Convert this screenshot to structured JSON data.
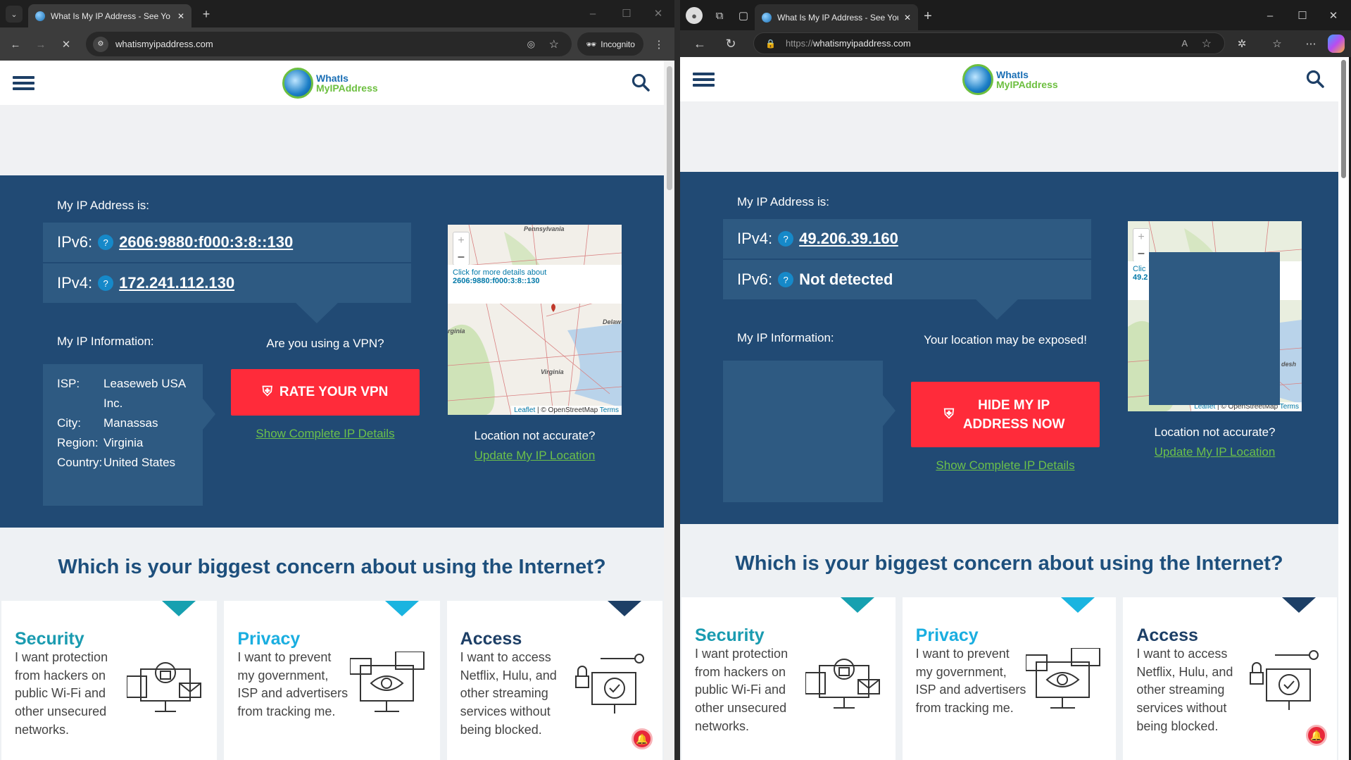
{
  "left": {
    "tab_title": "What Is My IP Address - See Yo",
    "url": "whatismyipaddress.com",
    "incognito_label": "Incognito",
    "page": {
      "logo_text": [
        "WhatIs",
        "MyIPAddress"
      ],
      "ip_heading": "My IP Address is:",
      "rows": [
        {
          "label": "IPv6:",
          "value": "2606:9880:f000:3:8::130"
        },
        {
          "label": "IPv4:",
          "value": "172.241.112.130"
        }
      ],
      "info_heading": "My IP Information:",
      "cta_heading": "Are you using a VPN?",
      "info": [
        {
          "key": "ISP:",
          "value": "Leaseweb USA Inc."
        },
        {
          "key": "City:",
          "value": "Manassas"
        },
        {
          "key": "Region:",
          "value": "Virginia"
        },
        {
          "key": "Country:",
          "value": "United States"
        }
      ],
      "cta_button": "RATE YOUR VPN",
      "details_link": "Show Complete IP Details",
      "map": {
        "popup_line1": "Click for more details about",
        "popup_line2": "2606:9880:f000:3:8::130",
        "labels": [
          "Pennsylvania",
          "Delaw",
          "rginia",
          "Virginia"
        ],
        "attribution": [
          "Leaflet",
          "© OpenStreetMap",
          "Terms"
        ]
      },
      "loc_question": "Location not accurate?",
      "loc_link": "Update My IP Location"
    }
  },
  "right": {
    "tab_title": "What Is My IP Address - See Your",
    "url_scheme": "https://",
    "url": "whatismyipaddress.com",
    "page": {
      "logo_text": [
        "WhatIs",
        "MyIPAddress"
      ],
      "ip_heading": "My IP Address is:",
      "rows": [
        {
          "label": "IPv4:",
          "value": "49.206.39.160"
        },
        {
          "label": "IPv6:",
          "value": "Not detected"
        }
      ],
      "info_heading": "My IP Information:",
      "cta_heading": "Your location may be exposed!",
      "cta_button": "HIDE MY IP ADDRESS NOW",
      "details_link": "Show Complete IP Details",
      "map": {
        "popup_line1": "Clic",
        "popup_line2": "49.2",
        "labels": [
          "desh"
        ],
        "attribution": [
          "Leaflet",
          "© OpenStreetMap",
          "Terms"
        ]
      },
      "loc_question": "Location not accurate?",
      "loc_link": "Update My IP Location"
    }
  },
  "concern": {
    "heading": "Which is your biggest concern about using the Internet?",
    "cards": [
      {
        "title": "Security",
        "text": "I want protection from hackers on public Wi-Fi and other unsecured networks.",
        "color": "#16a0b0",
        "title_color": "#1a9bb0"
      },
      {
        "title": "Privacy",
        "text": "I want to prevent my government, ISP and advertisers from tracking me.",
        "color": "#1ab4e0",
        "title_color": "#1aaee0"
      },
      {
        "title": "Access",
        "text": "I want to access Netflix, Hulu, and other streaming services without being blocked.",
        "color": "#1d3f66",
        "title_color": "#1d3f66"
      }
    ]
  },
  "colors": {
    "navy": "#214a74",
    "panel": "#2e5a82",
    "cta_red": "#ff2b3a",
    "link_green": "#6cc04a"
  }
}
